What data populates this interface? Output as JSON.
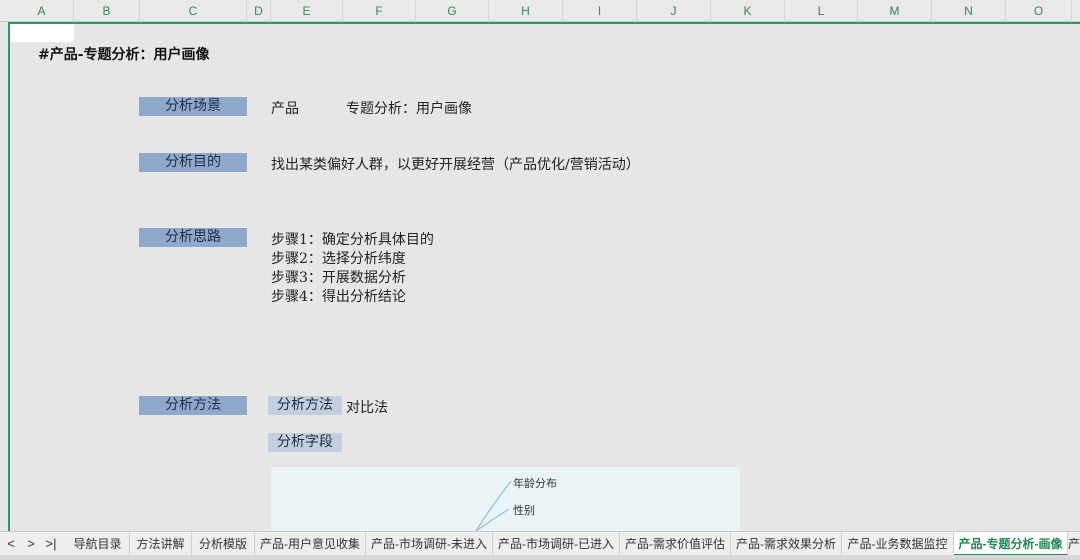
{
  "columns": [
    "A",
    "B",
    "C",
    "D",
    "E",
    "F",
    "G",
    "H",
    "I",
    "J",
    "K",
    "L",
    "M",
    "N",
    "O"
  ],
  "sheet": {
    "title": "#产品-专题分析：用户画像",
    "sections": {
      "scene": {
        "label": "分析场景",
        "value1": "产品",
        "value2": "专题分析：用户画像"
      },
      "purpose": {
        "label": "分析目的",
        "value": "找出某类偏好人群，以更好开展经营（产品优化/营销活动）"
      },
      "approach": {
        "label": "分析思路",
        "steps": [
          "步骤1：确定分析具体目的",
          "步骤2：选择分析纬度",
          "步骤3：开展数据分析",
          "步骤4：得出分析结论"
        ]
      },
      "method": {
        "label": "分析方法",
        "sub_label": "分析方法",
        "sub_value": "对比法",
        "field_label": "分析字段"
      }
    },
    "mindmap": {
      "nodes": [
        "年龄分布",
        "性别"
      ]
    }
  },
  "tabs": {
    "nav": [
      "<",
      ">",
      ">|"
    ],
    "items": [
      "导航目录",
      "方法讲解",
      "分析模版",
      "产品-用户意见收集",
      "产品-市场调研-未进入",
      "产品-市场调研-已进入",
      "产品-需求价值评估",
      "产品-需求效果分析",
      "产品-业务数据监控",
      "产品-专题分析-画像",
      "产"
    ],
    "active_index": 9
  },
  "colors": {
    "accent": "#2f9966",
    "label_bg": "#8ea9cc",
    "active_tab": "#1e8a52"
  }
}
